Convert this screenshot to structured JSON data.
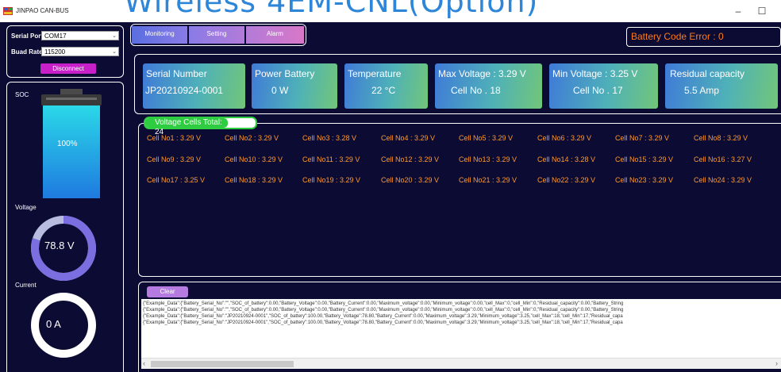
{
  "window": {
    "title": "JINPAO CAN-BUS",
    "overlay_title": "Wireless 4EM-CNL(Option)",
    "minimize": "–",
    "maximize": "☐"
  },
  "connection": {
    "serial_port_label": "Serial Port",
    "serial_port_value": "COM17",
    "baud_rate_label": "Buad Rate",
    "baud_rate_value": "115200",
    "disconnect_label": "Disconnect"
  },
  "tabs": [
    {
      "label": "Monitoring"
    },
    {
      "label": "Setting"
    },
    {
      "label": "Alarm"
    }
  ],
  "battery_code": "Battery Code Error : 0",
  "cards": [
    {
      "title": "Serial Number",
      "value": "JP20210924-0001"
    },
    {
      "title": "Power Battery",
      "value": "0 W"
    },
    {
      "title": "Temperature",
      "value": "22  °C"
    },
    {
      "title": "Max Voltage :  3.29 V",
      "value": "Cell No . 18"
    },
    {
      "title": "Min Voltage :  3.25 V",
      "value": "Cell No . 17"
    },
    {
      "title": "Residual capacity",
      "value": "5.5 Amp"
    }
  ],
  "soc": {
    "label": "SOC",
    "value": "100%",
    "level": 1.0
  },
  "voltage": {
    "label": "Voltage",
    "value": "78.8 V",
    "level": 0.8
  },
  "current": {
    "label": "Current",
    "value": "0 A",
    "level": 0.0
  },
  "voltage_cells_label": "Voltage Cells Total:  24",
  "cells": [
    "Cell No1 : 3.29 V",
    "Cell No2 : 3.29 V",
    "Cell No3 : 3.28 V",
    "Cell No4 : 3.29 V",
    "Cell No5 : 3.29 V",
    "Cell No6 : 3.29 V",
    "Cell No7 : 3.29 V",
    "Cell No8 : 3.29 V",
    "Cell No9 : 3.29 V",
    "Cell No10 : 3.29 V",
    "Cell No11 : 3.29 V",
    "Cell No12 : 3.29 V",
    "Cell No13 : 3.29 V",
    "Cell No14 : 3.28 V",
    "Cell No15 : 3.29 V",
    "Cell No16 : 3.27 V",
    "Cell No17 : 3.25 V",
    "Cell No18 : 3.29 V",
    "Cell No19 : 3.29 V",
    "Cell No20 : 3.29 V",
    "Cell No21 : 3.29 V",
    "Cell No22 : 3.29 V",
    "Cell No23 : 3.29 V",
    "Cell No24 : 3.29 V"
  ],
  "clear_label": "Clear",
  "log_lines": [
    "{\"Example_Data\":{\"Battery_Serial_No\":\"\",\"SOC_of_battery\":0.00,\"Battery_Voltage\":0.00,\"Battery_Current\":0.00,\"Maximum_voltage\":0.00,\"Minimum_voltage\":0.00,\"cell_Max\":0,\"cell_Min\":0,\"Residual_capacity\":0.00,\"Battery_String",
    "{\"Example_Data\":{\"Battery_Serial_No\":\"\",\"SOC_of_battery\":0.00,\"Battery_Voltage\":0.00,\"Battery_Current\":0.00,\"Maximum_voltage\":0.00,\"Minimum_voltage\":0.00,\"cell_Max\":0,\"cell_Min\":0,\"Residual_capacity\":0.00,\"Battery_String",
    "{\"Example_Data\":{\"Battery_Serial_No\":\"JP20210924-0001\",\"SOC_of_battery\":100.00,\"Battery_Voltage\":78.80,\"Battery_Current\":0.00,\"Maximum_voltage\":3.29,\"Minimum_voltage\":3.25,\"cell_Max\":18,\"cell_Min\":17,\"Residual_capa",
    "{\"Example_Data\":{\"Battery_Serial_No\":\"JP20210924-0001\",\"SOC_of_battery\":100.00,\"Battery_Voltage\":78.80,\"Battery_Current\":0.00,\"Maximum_voltage\":3.29,\"Minimum_voltage\":3.25,\"cell_Max\":18,\"cell_Min\":17,\"Residual_capa"
  ],
  "colors": {
    "background": "#0b0b33",
    "cell_text": "#ff9a2e",
    "error_text": "#ff7a1a",
    "tag_green": "#2ecc40"
  }
}
